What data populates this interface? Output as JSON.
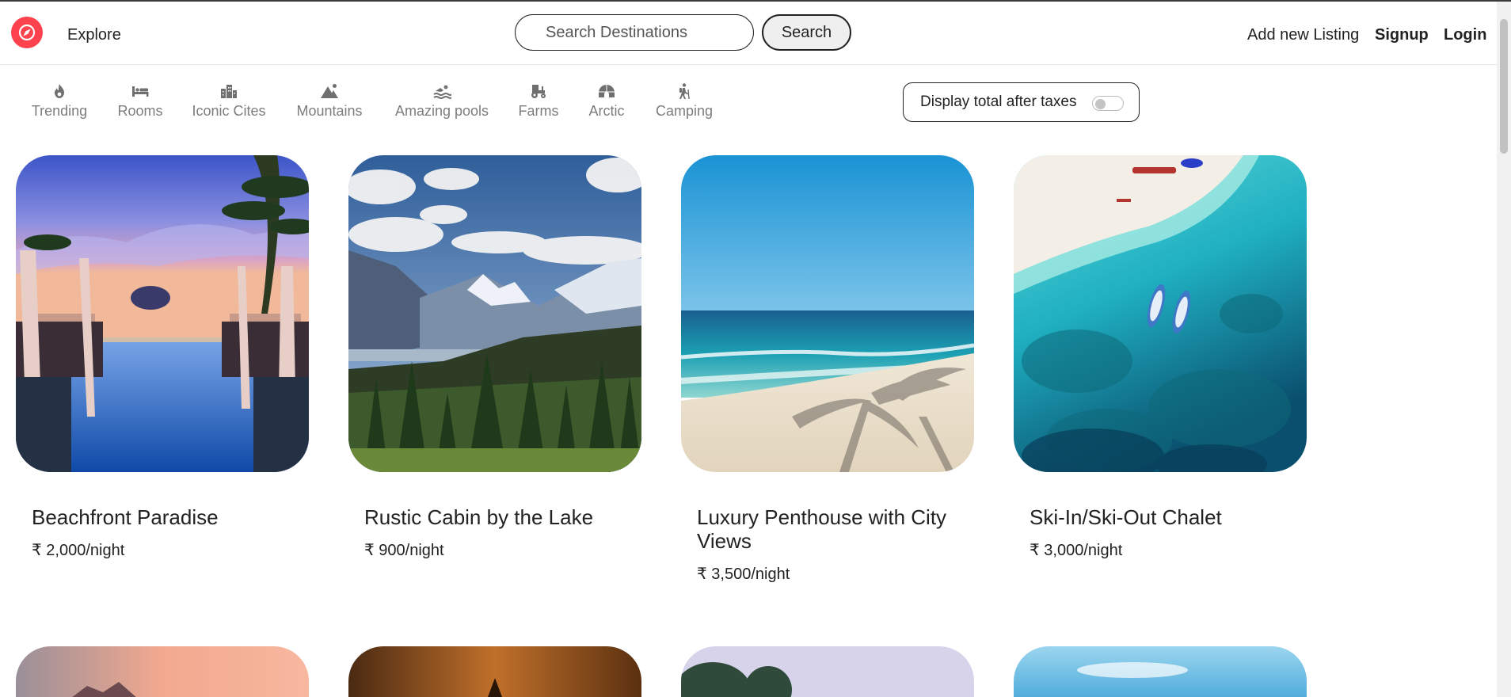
{
  "navbar": {
    "explore_label": "Explore",
    "search_placeholder": "Search Destinations",
    "search_button": "Search",
    "add_listing": "Add new Listing",
    "signup": "Signup",
    "login": "Login",
    "brand_color": "#fe424d"
  },
  "filters": [
    {
      "label": "Trending",
      "icon": "fire-icon"
    },
    {
      "label": "Rooms",
      "icon": "bed-icon"
    },
    {
      "label": "Iconic Cites",
      "icon": "city-icon"
    },
    {
      "label": "Mountains",
      "icon": "mountain-icon"
    },
    {
      "label": "Amazing pools",
      "icon": "swimmer-icon"
    },
    {
      "label": "Farms",
      "icon": "tractor-icon"
    },
    {
      "label": "Arctic",
      "icon": "igloo-icon"
    },
    {
      "label": "Camping",
      "icon": "hiker-icon"
    }
  ],
  "tax_toggle": {
    "label": "Display total after taxes",
    "enabled": false
  },
  "listings": [
    {
      "title": "Beachfront Paradise",
      "price": "₹ 2,000/night"
    },
    {
      "title": "Rustic Cabin by the Lake",
      "price": "₹ 900/night"
    },
    {
      "title": "Luxury Penthouse with City Views",
      "price": "₹ 3,500/night"
    },
    {
      "title": "Ski-In/Ski-Out Chalet",
      "price": "₹ 3,000/night"
    }
  ]
}
